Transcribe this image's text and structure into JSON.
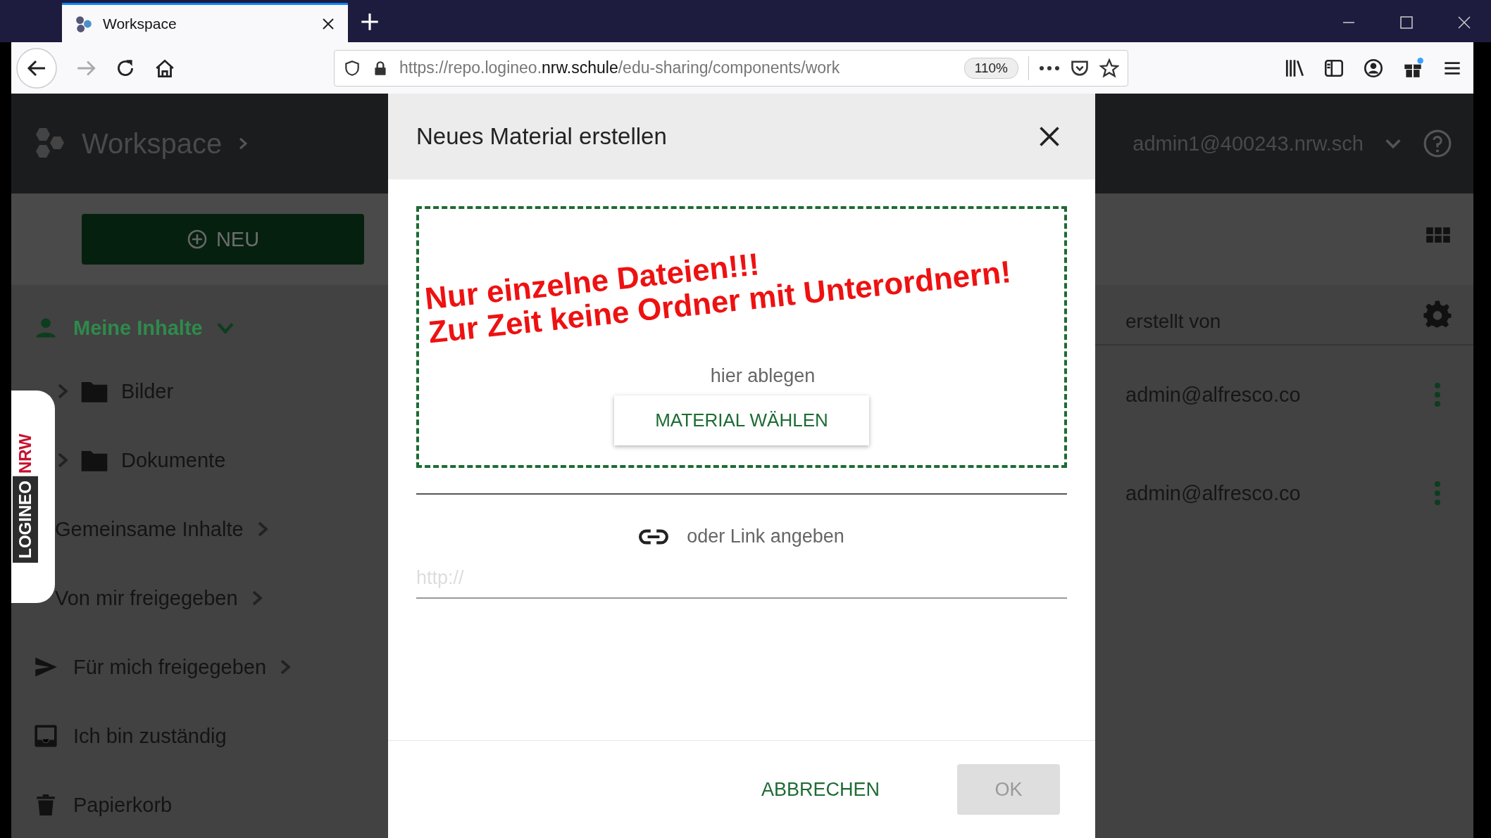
{
  "browser": {
    "tab": {
      "title": "Workspace"
    },
    "url": "https://repo.logineo.**nrw.schule**/edu-sharing/components/work",
    "zoom": "110%"
  },
  "header": {
    "title": "Workspace",
    "user": "admin1@400243.nrw.sch"
  },
  "new_button": "NEU",
  "sidebar": {
    "items": [
      {
        "label": "Meine Inhalte",
        "kind": "person",
        "selected": true,
        "expanded": true,
        "children": [
          {
            "label": "Bilder",
            "kind": "folder",
            "selected": false,
            "expanded": false
          },
          {
            "label": "Dokumente",
            "kind": "folder",
            "selected": false,
            "expanded": false
          }
        ]
      },
      {
        "label": "Gemeinsame Inhalte",
        "kind": "covered",
        "selected": false,
        "expanded": false
      },
      {
        "label": "Von mir freigegeben",
        "kind": "covered",
        "selected": false,
        "expanded": false
      },
      {
        "label": "Für mich freigegeben",
        "kind": "send",
        "selected": false,
        "expanded": false
      },
      {
        "label": "Ich bin zuständig",
        "kind": "inbox",
        "selected": false
      },
      {
        "label": "Papierkorb",
        "kind": "trash",
        "selected": false
      }
    ]
  },
  "logo_tab": {
    "word": "LOGINEO",
    "suffix": "NRW"
  },
  "table": {
    "columns": [
      "erstellt von"
    ],
    "rows": [
      {
        "created_by": "admin@alfresco.co"
      },
      {
        "created_by": "admin@alfresco.co"
      }
    ]
  },
  "dialog": {
    "title": "Neues Material erstellen",
    "drop_hint": "hier ablegen",
    "choose_button": "MATERIAL WÄHLEN",
    "link_label": "oder Link angeben",
    "link_field": {
      "placeholder": "http://"
    },
    "buttons": [
      {
        "label": "ABBRECHEN",
        "kind": "text",
        "disabled": false
      },
      {
        "label": "OK",
        "kind": "primary",
        "disabled": true
      }
    ]
  },
  "annotation": {
    "lines": [
      "Nur einzelne Dateien!!!",
      "Zur Zeit keine Ordner mit Unterordnern!"
    ]
  }
}
